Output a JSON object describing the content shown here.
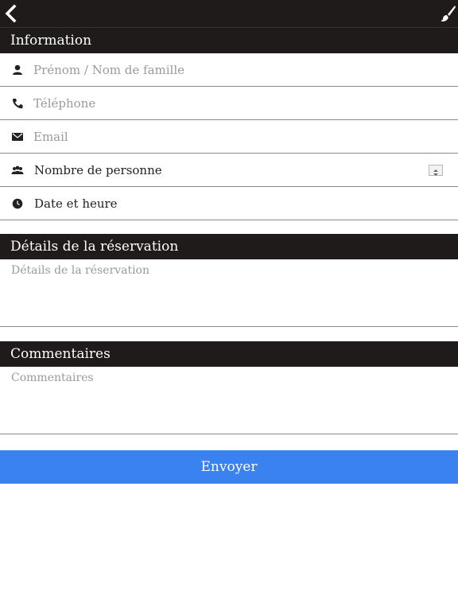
{
  "toolbar": {
    "back_icon": "chevron-left-icon",
    "right_icon": "paint-brush-icon"
  },
  "information": {
    "title": "Information",
    "name_placeholder": "Prénom / Nom de famille",
    "phone_placeholder": "Téléphone",
    "email_placeholder": "Email",
    "persons_label": "Nombre de personne",
    "datetime_label": "Date et heure"
  },
  "details": {
    "title": "Détails de la réservation",
    "placeholder": "Détails de la réservation"
  },
  "comments": {
    "title": "Commentaires",
    "placeholder": "Commentaires"
  },
  "submit": {
    "label": "Envoyer"
  },
  "colors": {
    "header_bg": "#1f1b1a",
    "button_bg": "#3b82f1",
    "divider": "#8a8a8a"
  }
}
